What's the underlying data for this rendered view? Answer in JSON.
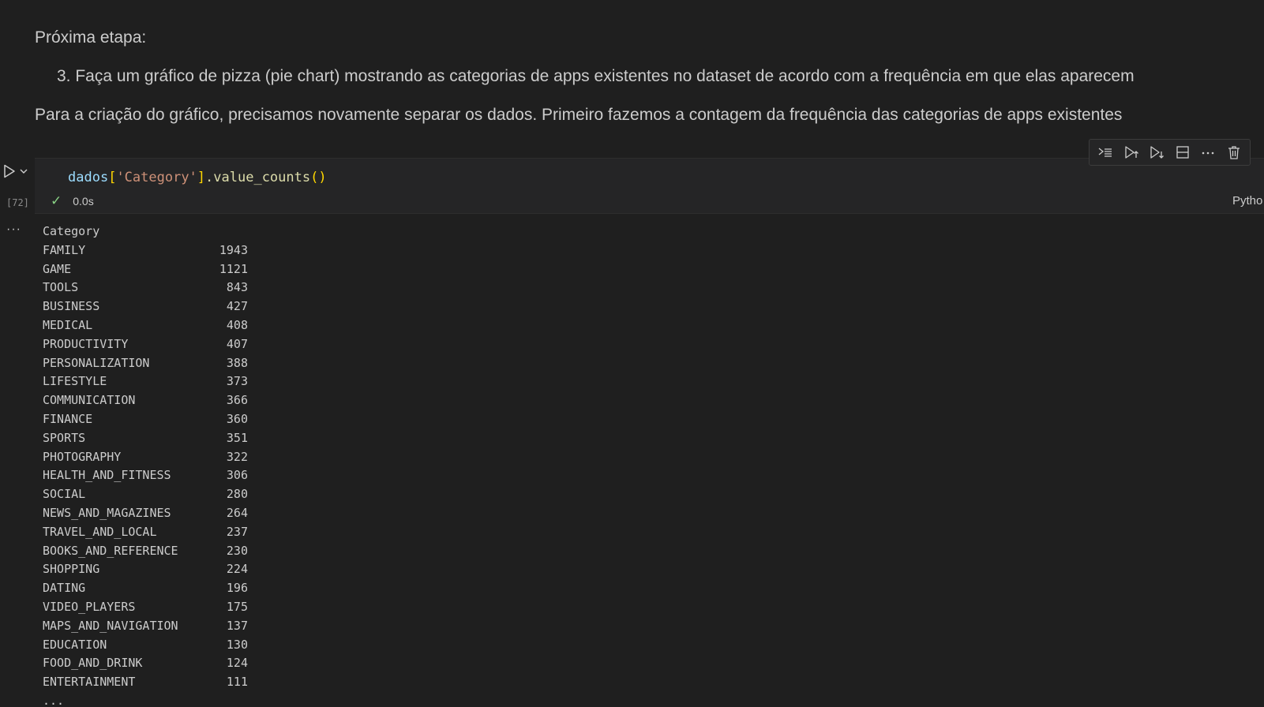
{
  "markdown": {
    "heading": "Próxima etapa:",
    "list_item": "3. Faça um gráfico de pizza (pie chart) mostrando as categorias de apps existentes no dataset de acordo com a frequência em que elas aparecem",
    "paragraph": "Para a criação do gráfico, precisamos novamente separar os dados. Primeiro fazemos a contagem da frequência das categorias de apps existentes"
  },
  "cell": {
    "code": {
      "var": "dados",
      "open_bracket": "[",
      "string": "'Category'",
      "close_bracket": "]",
      "method": ".value_counts",
      "parens": "()"
    },
    "execution_count": "[72]",
    "status_time": "0.0s",
    "kernel": "Pytho"
  },
  "toolbar": {
    "icons": [
      "execute-above-icon",
      "run-above-icon",
      "run-below-icon",
      "split-cell-icon",
      "more-actions-icon",
      "delete-icon"
    ]
  },
  "output": {
    "header": "Category",
    "rows": [
      {
        "category": "FAMILY",
        "count": "1943"
      },
      {
        "category": "GAME",
        "count": "1121"
      },
      {
        "category": "TOOLS",
        "count": "843"
      },
      {
        "category": "BUSINESS",
        "count": "427"
      },
      {
        "category": "MEDICAL",
        "count": "408"
      },
      {
        "category": "PRODUCTIVITY",
        "count": "407"
      },
      {
        "category": "PERSONALIZATION",
        "count": "388"
      },
      {
        "category": "LIFESTYLE",
        "count": "373"
      },
      {
        "category": "COMMUNICATION",
        "count": "366"
      },
      {
        "category": "FINANCE",
        "count": "360"
      },
      {
        "category": "SPORTS",
        "count": "351"
      },
      {
        "category": "PHOTOGRAPHY",
        "count": "322"
      },
      {
        "category": "HEALTH_AND_FITNESS",
        "count": "306"
      },
      {
        "category": "SOCIAL",
        "count": "280"
      },
      {
        "category": "NEWS_AND_MAGAZINES",
        "count": "264"
      },
      {
        "category": "TRAVEL_AND_LOCAL",
        "count": "237"
      },
      {
        "category": "BOOKS_AND_REFERENCE",
        "count": "230"
      },
      {
        "category": "SHOPPING",
        "count": "224"
      },
      {
        "category": "DATING",
        "count": "196"
      },
      {
        "category": "VIDEO_PLAYERS",
        "count": "175"
      },
      {
        "category": "MAPS_AND_NAVIGATION",
        "count": "137"
      },
      {
        "category": "EDUCATION",
        "count": "130"
      },
      {
        "category": "FOOD_AND_DRINK",
        "count": "124"
      },
      {
        "category": "ENTERTAINMENT",
        "count": "111"
      }
    ],
    "ellipsis": "..."
  },
  "colors": {
    "background": "#1f1f1f",
    "cell_background": "#252526",
    "success_check": "#89d185"
  }
}
